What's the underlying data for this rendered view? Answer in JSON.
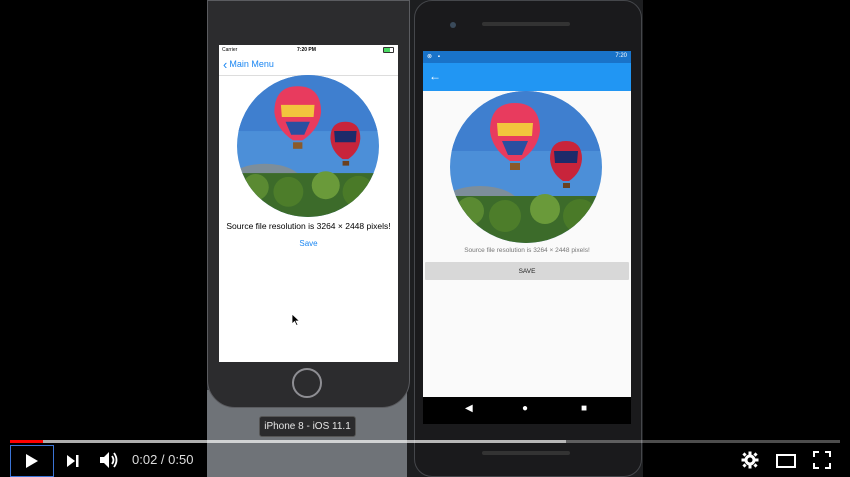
{
  "iphone": {
    "carrier": "Carrier",
    "time": "7:20 PM",
    "back_label": "Main Menu",
    "resolution_text": "Source file resolution is 3264 × 2448 pixels!",
    "save_label": "Save"
  },
  "simulator_label": "iPhone 8 - iOS 11.1",
  "android": {
    "time": "7:20",
    "resolution_text": "Source file resolution is 3264 × 2448 pixels!",
    "save_label": "SAVE"
  },
  "player": {
    "current_time": "0:02",
    "separator": " / ",
    "duration": "0:50",
    "progress": 0.04,
    "buffered": 0.63
  },
  "colors": {
    "ios_tint": "#1a86f2",
    "android_primary": "#2196f3",
    "android_status": "#1973c9",
    "progress_red": "#ff0000"
  },
  "icons": {
    "back_ios": "chevron-left-icon",
    "back_android": "arrow-left-icon",
    "android_nav": [
      "back-triangle-icon",
      "home-circle-icon",
      "recents-square-icon"
    ],
    "player": [
      "play-icon",
      "next-icon",
      "volume-icon",
      "settings-icon",
      "theater-icon",
      "fullscreen-icon"
    ]
  }
}
